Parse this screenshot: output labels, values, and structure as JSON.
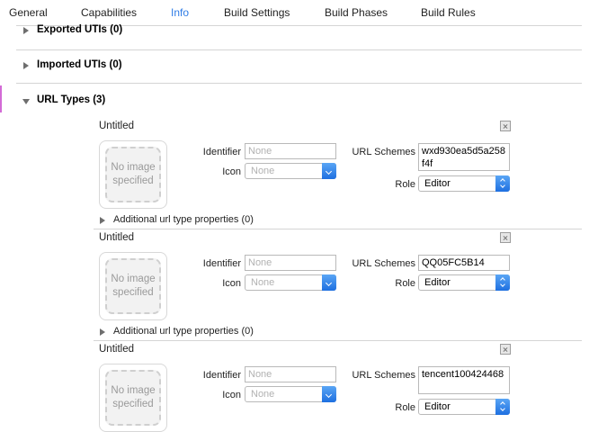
{
  "tabs": [
    {
      "label": "General"
    },
    {
      "label": "Capabilities"
    },
    {
      "label": "Info"
    },
    {
      "label": "Build Settings"
    },
    {
      "label": "Build Phases"
    },
    {
      "label": "Build Rules"
    }
  ],
  "active_tab": "Info",
  "sections": {
    "exported_utis": {
      "title": "Exported UTIs (0)"
    },
    "imported_utis": {
      "title": "Imported UTIs (0)"
    },
    "url_types": {
      "title": "URL Types (3)"
    }
  },
  "labels": {
    "identifier": "Identifier",
    "icon": "Icon",
    "url_schemes": "URL Schemes",
    "role": "Role",
    "no_image": "No image specified",
    "additional_props": "Additional url type properties (0)"
  },
  "url_types": [
    {
      "title": "Untitled",
      "identifier_placeholder": "None",
      "icon_value": "None",
      "url_schemes": "wxd930ea5d5a258f4f",
      "role": "Editor"
    },
    {
      "title": "Untitled",
      "identifier_placeholder": "None",
      "icon_value": "None",
      "url_schemes": "QQ05FC5B14",
      "role": "Editor"
    },
    {
      "title": "Untitled",
      "identifier_placeholder": "None",
      "icon_value": "None",
      "url_schemes": "tencent100424468",
      "role": "Editor"
    }
  ],
  "colors": {
    "accent": "#2e7ce6",
    "left_marker": "#d36bd6"
  }
}
